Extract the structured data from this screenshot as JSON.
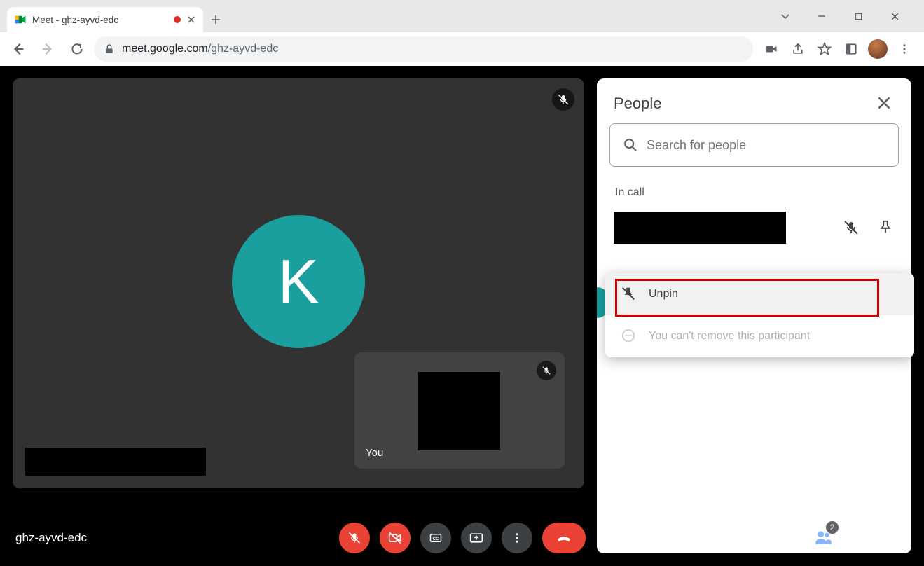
{
  "browser": {
    "tab_title": "Meet - ghz-ayvd-edc",
    "url_domain": "meet.google.com",
    "url_path": "/ghz-ayvd-edc"
  },
  "main_video": {
    "avatar_initial": "K"
  },
  "self_video": {
    "label": "You"
  },
  "people_panel": {
    "title": "People",
    "search_placeholder": "Search for people",
    "in_call_label": "In call"
  },
  "context_menu": {
    "unpin_label": "Unpin",
    "remove_disabled_label": "You can't remove this participant"
  },
  "bottom_bar": {
    "meeting_code": "ghz-ayvd-edc",
    "people_count": "2"
  }
}
